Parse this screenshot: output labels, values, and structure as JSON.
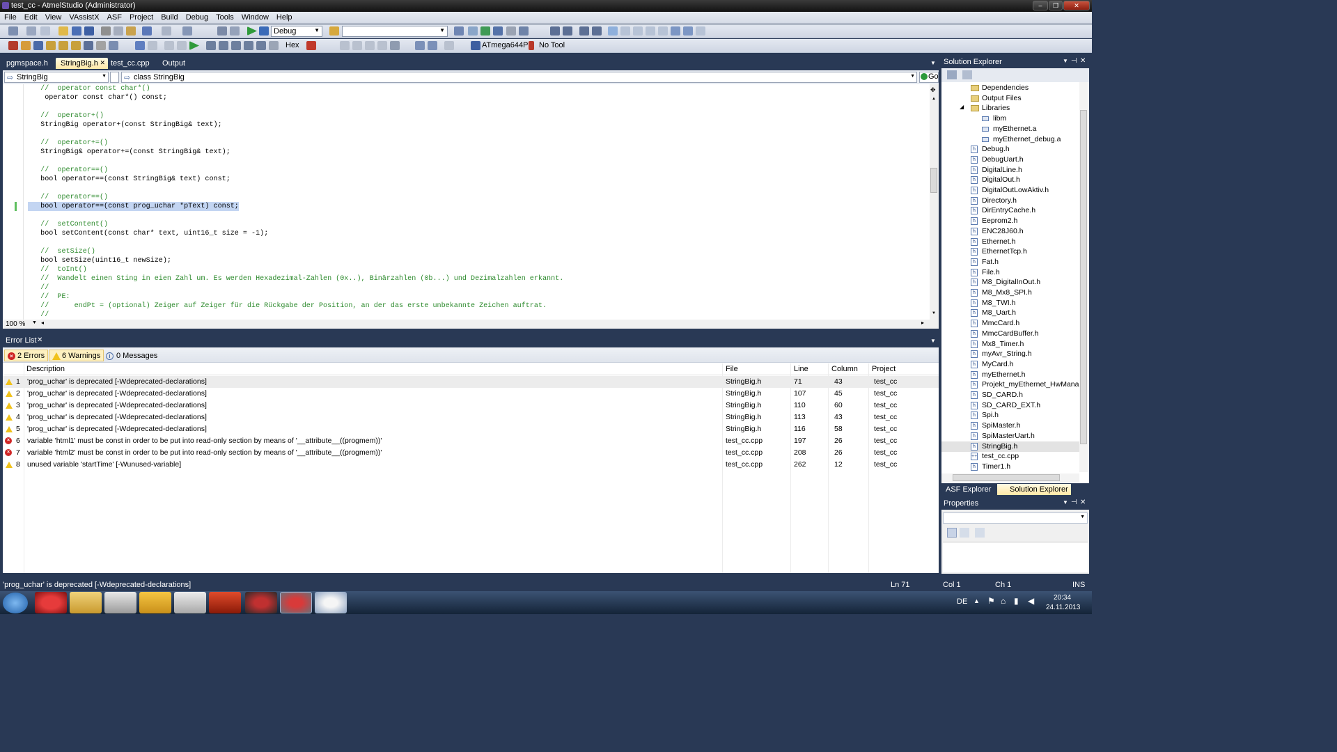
{
  "window": {
    "title": "test_cc - AtmelStudio (Administrator)",
    "min": "–",
    "max": "❐",
    "close": "✕"
  },
  "menu": [
    "File",
    "Edit",
    "View",
    "VAssistX",
    "ASF",
    "Project",
    "Build",
    "Debug",
    "Tools",
    "Window",
    "Help"
  ],
  "toolbar1": {
    "config": "Debug",
    "search": ""
  },
  "toolbar2": {
    "hex": "Hex",
    "device": "ATmega644P",
    "tool": "No Tool"
  },
  "tabs": [
    {
      "label": "pgmspace.h"
    },
    {
      "label": "StringBig.h",
      "active": true,
      "close": "✕"
    },
    {
      "label": "test_cc.cpp"
    },
    {
      "label": "Output"
    }
  ],
  "nav": {
    "left": "StringBig",
    "right": "class StringBig",
    "go": "Go"
  },
  "code": [
    {
      "t": "c",
      "s": "   //  operator const char*()"
    },
    {
      "t": "x",
      "s": "    operator const char*() const;"
    },
    {
      "t": "x",
      "s": ""
    },
    {
      "t": "c",
      "s": "   //  operator+()"
    },
    {
      "t": "x",
      "s": "   StringBig operator+(const StringBig& text);"
    },
    {
      "t": "x",
      "s": ""
    },
    {
      "t": "c",
      "s": "   //  operator+=()"
    },
    {
      "t": "x",
      "s": "   StringBig& operator+=(const StringBig& text);"
    },
    {
      "t": "x",
      "s": ""
    },
    {
      "t": "c",
      "s": "   //  operator==()"
    },
    {
      "t": "x",
      "s": "   bool operator==(const StringBig& text) const;"
    },
    {
      "t": "x",
      "s": ""
    },
    {
      "t": "c",
      "s": "   //  operator==()"
    },
    {
      "t": "h",
      "s": "   bool operator==(const prog_uchar *pText) const;"
    },
    {
      "t": "x",
      "s": ""
    },
    {
      "t": "c",
      "s": "   //  setContent()"
    },
    {
      "t": "x",
      "s": "   bool setContent(const char* text, uint16_t size = -1);"
    },
    {
      "t": "x",
      "s": ""
    },
    {
      "t": "c",
      "s": "   //  setSize()"
    },
    {
      "t": "x",
      "s": "   bool setSize(uint16_t newSize);"
    },
    {
      "t": "c",
      "s": "   //  toInt()"
    },
    {
      "t": "c",
      "s": "   //  Wandelt einen Sting in eien Zahl um. Es werden Hexadezimal-Zahlen (0x..), Binärzahlen (0b...) und Dezimalzahlen erkannt."
    },
    {
      "t": "c",
      "s": "   //"
    },
    {
      "t": "c",
      "s": "   //  PE:"
    },
    {
      "t": "c",
      "s": "   //      endPt = (optional) Zeiger auf Zeiger für die Rückgabe der Position, an der das erste unbekannte Zeichen auftrat."
    },
    {
      "t": "c",
      "s": "   //"
    }
  ],
  "zoom": "100 %",
  "errorlist": {
    "title": "Error List",
    "close": "✕",
    "errors": "2 Errors",
    "warnings": "6 Warnings",
    "messages": "0 Messages",
    "columns": {
      "description": "Description",
      "file": "File",
      "line": "Line",
      "column": "Column",
      "project": "Project"
    },
    "rows": [
      {
        "kind": "w",
        "num": "1",
        "desc": "'prog_uchar' is deprecated [-Wdeprecated-declarations]",
        "file": "StringBig.h",
        "line": "71",
        "col": "43",
        "proj": "test_cc"
      },
      {
        "kind": "w",
        "num": "2",
        "desc": "'prog_uchar' is deprecated [-Wdeprecated-declarations]",
        "file": "StringBig.h",
        "line": "107",
        "col": "45",
        "proj": "test_cc"
      },
      {
        "kind": "w",
        "num": "3",
        "desc": "'prog_uchar' is deprecated [-Wdeprecated-declarations]",
        "file": "StringBig.h",
        "line": "110",
        "col": "60",
        "proj": "test_cc"
      },
      {
        "kind": "w",
        "num": "4",
        "desc": "'prog_uchar' is deprecated [-Wdeprecated-declarations]",
        "file": "StringBig.h",
        "line": "113",
        "col": "43",
        "proj": "test_cc"
      },
      {
        "kind": "w",
        "num": "5",
        "desc": "'prog_uchar' is deprecated [-Wdeprecated-declarations]",
        "file": "StringBig.h",
        "line": "116",
        "col": "58",
        "proj": "test_cc"
      },
      {
        "kind": "e",
        "num": "6",
        "desc": "variable 'html1' must be const in order to be put into read-only section by means of '__attribute__((progmem))'",
        "file": "test_cc.cpp",
        "line": "197",
        "col": "26",
        "proj": "test_cc"
      },
      {
        "kind": "e",
        "num": "7",
        "desc": "variable 'html2' must be const in order to be put into read-only section by means of '__attribute__((progmem))'",
        "file": "test_cc.cpp",
        "line": "208",
        "col": "26",
        "proj": "test_cc"
      },
      {
        "kind": "w",
        "num": "8",
        "desc": "unused variable 'startTime' [-Wunused-variable]",
        "file": "test_cc.cpp",
        "line": "262",
        "col": "12",
        "proj": "test_cc"
      }
    ]
  },
  "solution_explorer": {
    "title": "Solution Explorer",
    "items": [
      {
        "label": "Dependencies",
        "type": "folder",
        "indent": 2
      },
      {
        "label": "Output Files",
        "type": "folder",
        "indent": 2
      },
      {
        "label": "Libraries",
        "type": "folder",
        "indent": 2
      },
      {
        "label": "libm",
        "type": "lib",
        "indent": 3
      },
      {
        "label": "myEthernet.a",
        "type": "lib",
        "indent": 3
      },
      {
        "label": "myEthernet_debug.a",
        "type": "lib",
        "indent": 3
      },
      {
        "label": "Debug.h",
        "type": "h",
        "indent": 2
      },
      {
        "label": "DebugUart.h",
        "type": "h",
        "indent": 2
      },
      {
        "label": "DigitalLine.h",
        "type": "h",
        "indent": 2
      },
      {
        "label": "DigitalOut.h",
        "type": "h",
        "indent": 2
      },
      {
        "label": "DigitalOutLowAktiv.h",
        "type": "h",
        "indent": 2
      },
      {
        "label": "Directory.h",
        "type": "h",
        "indent": 2
      },
      {
        "label": "DirEntryCache.h",
        "type": "h",
        "indent": 2
      },
      {
        "label": "Eeprom2.h",
        "type": "h",
        "indent": 2
      },
      {
        "label": "ENC28J60.h",
        "type": "h",
        "indent": 2
      },
      {
        "label": "Ethernet.h",
        "type": "h",
        "indent": 2
      },
      {
        "label": "EthernetTcp.h",
        "type": "h",
        "indent": 2
      },
      {
        "label": "Fat.h",
        "type": "h",
        "indent": 2
      },
      {
        "label": "File.h",
        "type": "h",
        "indent": 2
      },
      {
        "label": "M8_DigitalInOut.h",
        "type": "h",
        "indent": 2
      },
      {
        "label": "M8_Mx8_SPI.h",
        "type": "h",
        "indent": 2
      },
      {
        "label": "M8_TWI.h",
        "type": "h",
        "indent": 2
      },
      {
        "label": "M8_Uart.h",
        "type": "h",
        "indent": 2
      },
      {
        "label": "MmcCard.h",
        "type": "h",
        "indent": 2
      },
      {
        "label": "MmcCardBuffer.h",
        "type": "h",
        "indent": 2
      },
      {
        "label": "Mx8_Timer.h",
        "type": "h",
        "indent": 2
      },
      {
        "label": "myAvr_String.h",
        "type": "h",
        "indent": 2
      },
      {
        "label": "MyCard.h",
        "type": "h",
        "indent": 2
      },
      {
        "label": "myEthernet.h",
        "type": "h",
        "indent": 2
      },
      {
        "label": "Projekt_myEthernet_HwManage",
        "type": "h",
        "indent": 2
      },
      {
        "label": "SD_CARD.h",
        "type": "h",
        "indent": 2
      },
      {
        "label": "SD_CARD_EXT.h",
        "type": "h",
        "indent": 2
      },
      {
        "label": "Spi.h",
        "type": "h",
        "indent": 2
      },
      {
        "label": "SpiMaster.h",
        "type": "h",
        "indent": 2
      },
      {
        "label": "SpiMasterUart.h",
        "type": "h",
        "indent": 2
      },
      {
        "label": "StringBig.h",
        "type": "h",
        "indent": 2
      },
      {
        "label": "test_cc.cpp",
        "type": "cpp",
        "indent": 2
      },
      {
        "label": "Timer1.h",
        "type": "h",
        "indent": 2
      }
    ],
    "tab_asf": "ASF Explorer",
    "tab_sol": "Solution Explorer"
  },
  "properties": {
    "title": "Properties"
  },
  "status": {
    "msg": "'prog_uchar' is deprecated [-Wdeprecated-declarations]",
    "ln": "Ln 71",
    "col": "Col 1",
    "ch": "Ch 1",
    "ins": "INS"
  },
  "taskbar": {
    "lang": "DE",
    "time": "20:34",
    "date": "24.11.2013"
  }
}
